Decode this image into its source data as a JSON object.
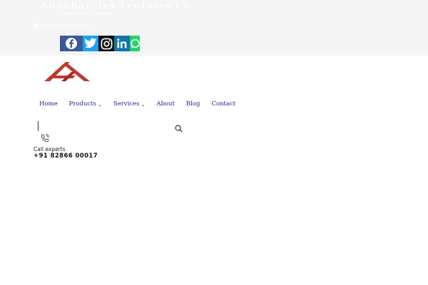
{
  "header": {
    "brand": "Shubhan Tex Ventures Co.",
    "tagline": "Manufacturer · Exporter",
    "contact_text": "info@example.com"
  },
  "social": [
    {
      "name": "facebook-icon",
      "color": "#3b5998"
    },
    {
      "name": "twitter-icon",
      "color": "#1da1f2"
    },
    {
      "name": "instagram-icon",
      "color": "#111111"
    },
    {
      "name": "linkedin-icon",
      "color": "#0e76a8"
    },
    {
      "name": "whatsapp-icon",
      "color": "#25d366"
    }
  ],
  "logo": {
    "color": "#c0392b"
  },
  "nav": {
    "home": "Home",
    "products": "Products",
    "services": "Services",
    "about": "About",
    "blog": "Blog",
    "contact": "Contact",
    "dropdown_glyph": "⌄"
  },
  "call": {
    "label": "Call experts",
    "number": "+91 82866 00017"
  }
}
